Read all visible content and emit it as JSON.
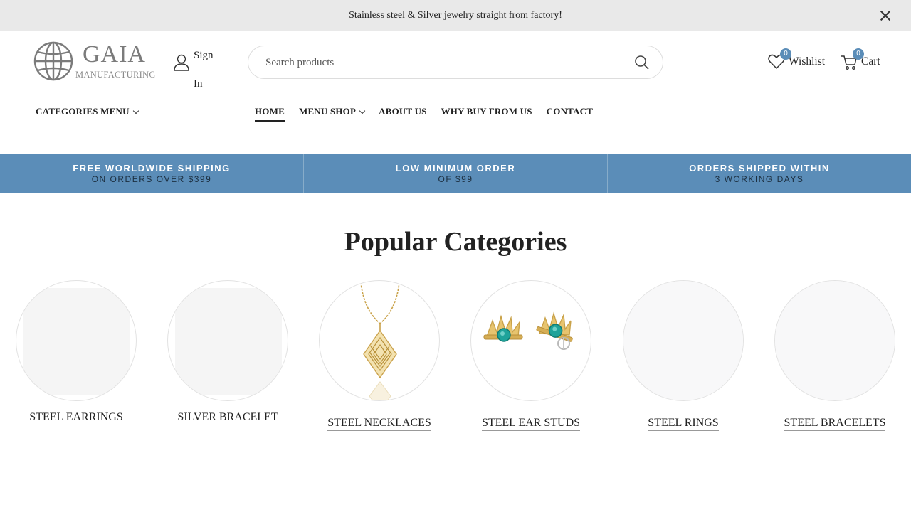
{
  "announcement": {
    "text": "Stainless steel & Silver jewelry straight from factory!"
  },
  "brand": {
    "name": "GAIA",
    "tagline": "MANUFACTURING"
  },
  "account": {
    "sign_in_line1": "Sign",
    "sign_in_line2": "In"
  },
  "search": {
    "placeholder": "Search products",
    "value": ""
  },
  "wishlist": {
    "label": "Wishlist",
    "count": "0"
  },
  "cart": {
    "label": "Cart",
    "count": "0"
  },
  "nav": {
    "categories_menu": "CATEGORIES MENU",
    "items": [
      {
        "label": "HOME"
      },
      {
        "label": "MENU SHOP"
      },
      {
        "label": "ABOUT US"
      },
      {
        "label": "WHY BUY FROM US"
      },
      {
        "label": "CONTACT"
      }
    ]
  },
  "promos": [
    {
      "title": "FREE WORLDWIDE SHIPPING",
      "subtitle": "ON ORDERS OVER $399"
    },
    {
      "title": "LOW MINIMUM ORDER",
      "subtitle": "OF $99"
    },
    {
      "title": "ORDERS SHIPPED WITHIN",
      "subtitle": "3 WORKING DAYS"
    }
  ],
  "popular": {
    "title": "Popular Categories",
    "categories": [
      {
        "label": "STEEL EARRINGS"
      },
      {
        "label": "SILVER BRACELET"
      },
      {
        "label": "STEEL NECKLACES"
      },
      {
        "label": "STEEL EAR STUDS"
      },
      {
        "label": "STEEL RINGS"
      },
      {
        "label": "STEEL BRACELETS"
      }
    ]
  },
  "colors": {
    "accent": "#5b8db8",
    "announce_bg": "#e9e9e9",
    "gold": "#d9b25a",
    "turquoise": "#1fa39a"
  }
}
